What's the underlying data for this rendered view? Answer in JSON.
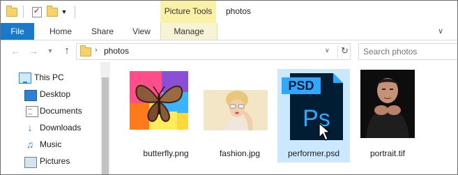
{
  "titlebar": {
    "contextual_tools": "Picture Tools",
    "window_title": "photos",
    "quick_access": [
      "folder-icon",
      "properties-icon",
      "new-folder-icon",
      "customize-dropdown-icon"
    ]
  },
  "ribbon": {
    "tabs": [
      {
        "id": "file",
        "label": "File"
      },
      {
        "id": "home",
        "label": "Home"
      },
      {
        "id": "share",
        "label": "Share"
      },
      {
        "id": "view",
        "label": "View"
      },
      {
        "id": "manage",
        "label": "Manage"
      }
    ]
  },
  "addressbar": {
    "path": "photos",
    "search_placeholder": "Search photos"
  },
  "navpane": {
    "items": [
      {
        "label": "This PC",
        "icon": "computer-icon"
      },
      {
        "label": "Desktop",
        "icon": "desktop-icon"
      },
      {
        "label": "Documents",
        "icon": "documents-icon"
      },
      {
        "label": "Downloads",
        "icon": "downloads-icon"
      },
      {
        "label": "Music",
        "icon": "music-icon"
      },
      {
        "label": "Pictures",
        "icon": "pictures-icon"
      }
    ]
  },
  "files": [
    {
      "name": "butterfly.png",
      "selected": false
    },
    {
      "name": "fashion.jpg",
      "selected": false
    },
    {
      "name": "performer.psd",
      "selected": true,
      "badge": "PSD",
      "glyph": "Ps"
    },
    {
      "name": "portrait.tif",
      "selected": false
    }
  ],
  "colors": {
    "file_tab": "#1979ca",
    "contextual": "#faf0a6",
    "selection": "#cce8ff",
    "psd_blue": "#001d34",
    "psd_accent": "#31a8ff"
  }
}
